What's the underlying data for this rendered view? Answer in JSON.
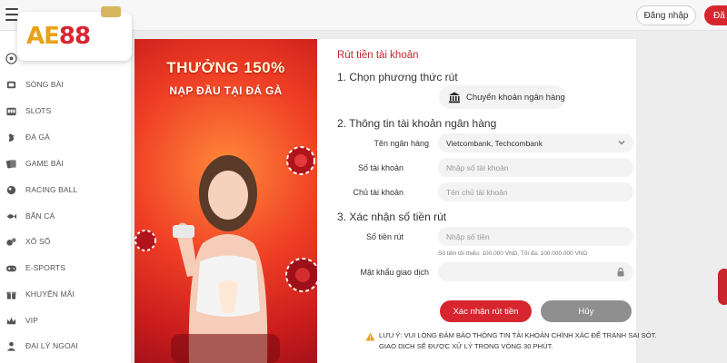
{
  "header": {
    "menu_icon": "hamburger-icon",
    "login_label": "Đăng nhập",
    "register_label": "Đă",
    "brand_color": "#d7262f"
  },
  "logo": {
    "text_a": "AE",
    "text_b": "88"
  },
  "sidebar": {
    "items": [
      {
        "label": "THỂ THAO",
        "icon": "soccer-ball-icon"
      },
      {
        "label": "SÒNG BÀI",
        "icon": "casino-chip-icon"
      },
      {
        "label": "SLOTS",
        "icon": "slot-machine-icon"
      },
      {
        "label": "ĐÁ GÀ",
        "icon": "rooster-icon"
      },
      {
        "label": "GAME BÀI",
        "icon": "cards-icon"
      },
      {
        "label": "RACING BALL",
        "icon": "racing-ball-icon"
      },
      {
        "label": "BẮN CÁ",
        "icon": "fish-icon"
      },
      {
        "label": "XỔ SỐ",
        "icon": "lottery-icon"
      },
      {
        "label": "E-SPORTS",
        "icon": "gamepad-icon"
      },
      {
        "label": "KHUYẾN MÃI",
        "icon": "gift-icon"
      },
      {
        "label": "VIP",
        "icon": "crown-icon"
      },
      {
        "label": "ĐẠI LÝ NGOẠI",
        "icon": "agent-icon"
      }
    ]
  },
  "promo": {
    "title": "THƯỞNG 150%",
    "subtitle": "NẠP ĐẦU TẠI ĐÁ GÀ"
  },
  "form": {
    "title": "Rút tiền tài khoản",
    "step1": "1. Chọn phương thức rút",
    "method_label": "Chuyển khoản ngân hàng",
    "step2": "2. Thông tin tài khoản ngân hàng",
    "bank_name_label": "Tên ngân hàng",
    "bank_name_value": "Vietcombank, Techcombank",
    "account_number_label": "Số tài khoản",
    "account_number_placeholder": "Nhập số tài khoản",
    "account_owner_label": "Chủ tài khoản",
    "account_owner_placeholder": "Tên chủ tài khoản",
    "step3": "3. Xác nhận số tiền rút",
    "amount_label": "Số tiền rút",
    "amount_placeholder": "Nhập số tiền",
    "amount_hint": "Số tiền tối thiểu: 100.000 VND, Tối đa: 100.000.000 VND",
    "password_label": "Mật khẩu giao dịch",
    "confirm_button": "Xác nhận rút tiền",
    "cancel_button": "Hủy",
    "note_line1": "LƯU Ý: VUI LÒNG ĐẢM BẢO THÔNG TIN TÀI KHOẢN CHÍNH XÁC ĐỂ TRÁNH SAI SÓT.",
    "note_line2": "GIAO DỊCH SẼ ĐƯỢC XỬ LÝ TRONG VÒNG 30 PHÚT."
  }
}
